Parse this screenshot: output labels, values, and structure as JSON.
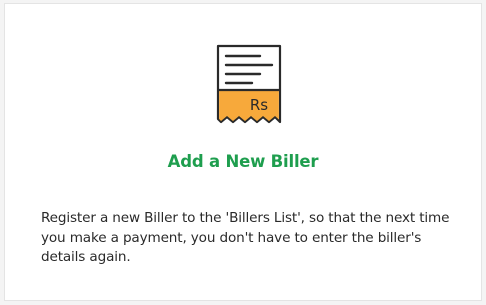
{
  "colors": {
    "accent_green": "#1e9e4e",
    "text_dark": "#2a2a2a",
    "receipt_orange": "#f7a93b",
    "outline": "#2a2a2a"
  },
  "card": {
    "icon": "receipt-rupee-icon",
    "currency_symbol": "Rs",
    "title": "Add a New Biller",
    "description": "Register a new Biller to the 'Billers List', so that the next time you make a payment, you don't have to enter the biller's details again."
  }
}
